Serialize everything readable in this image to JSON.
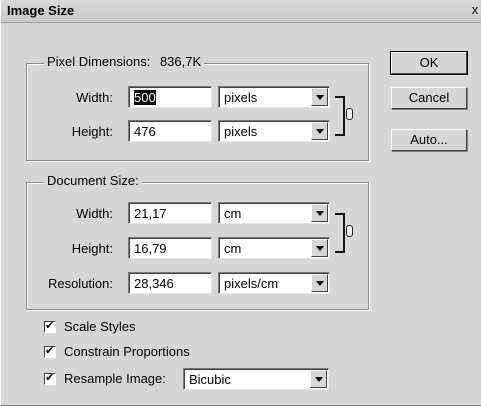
{
  "window": {
    "title": "Image Size",
    "close_glyph": "x"
  },
  "pixel_dimensions": {
    "legend_label": "Pixel Dimensions:",
    "size_value": "836,7K",
    "width": {
      "label": "Width:",
      "value": "500",
      "unit": "pixels"
    },
    "height": {
      "label": "Height:",
      "value": "476",
      "unit": "pixels"
    }
  },
  "document_size": {
    "legend_label": "Document Size:",
    "width": {
      "label": "Width:",
      "value": "21,17",
      "unit": "cm"
    },
    "height": {
      "label": "Height:",
      "value": "16,79",
      "unit": "cm"
    },
    "resolution": {
      "label": "Resolution:",
      "value": "28,346",
      "unit": "pixels/cm"
    }
  },
  "buttons": {
    "ok": "OK",
    "cancel": "Cancel",
    "auto": "Auto..."
  },
  "options": {
    "scale_styles": {
      "label": "Scale Styles",
      "checked": true
    },
    "constrain_proportions": {
      "label": "Constrain Proportions",
      "checked": true
    },
    "resample": {
      "label": "Resample Image:",
      "checked": true,
      "method": "Bicubic"
    }
  },
  "icons": {
    "link": "chain-link-icon",
    "dropdown": "chevron-down-icon"
  }
}
